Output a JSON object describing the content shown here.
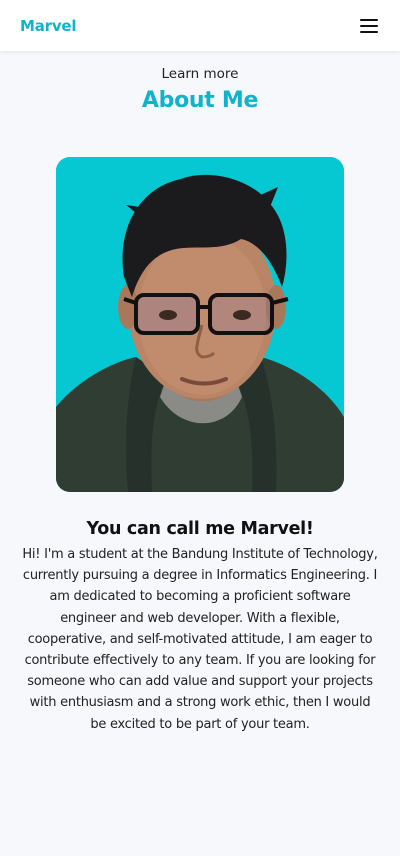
{
  "navbar": {
    "brand": "Marvel",
    "menu_icon": "hamburger-menu-icon"
  },
  "about": {
    "subtitle": "Learn more",
    "title": "About Me",
    "photo_background": "#06c8d2",
    "headline": "You can call me Marvel!",
    "bio": "Hi! I'm a student at the Bandung Institute of Technology, currently pursuing a degree in Informatics Engineering. I am dedicated to becoming a proficient software engineer and web developer. With a flexible, cooperative, and self-motivated attitude, I am eager to contribute effectively to any team. If you are looking for someone who can add value and support your projects with enthusiasm and a strong work ethic, then I would be excited to be part of your team."
  },
  "colors": {
    "accent": "#10b3cc",
    "background": "#f7f8fb"
  }
}
